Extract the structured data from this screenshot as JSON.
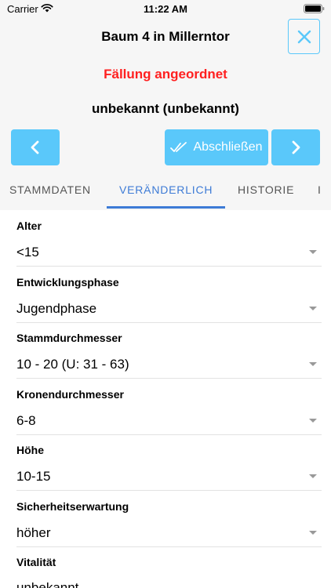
{
  "status_bar": {
    "carrier": "Carrier",
    "time": "11:22 AM"
  },
  "header": {
    "title": "Baum 4 in Millerntor",
    "subtitle": "Fällung angeordnet",
    "species": "unbekannt (unbekannt)",
    "finish_label": "Abschließen"
  },
  "tabs": [
    "STAMMDATEN",
    "VERÄNDERLICH",
    "HISTORIE",
    "I"
  ],
  "active_tab": "VERÄNDERLICH",
  "fields": [
    {
      "label": "Alter",
      "value": "<15"
    },
    {
      "label": "Entwicklungsphase",
      "value": "Jugendphase"
    },
    {
      "label": "Stammdurchmesser",
      "value": "10 - 20 (U: 31 - 63)"
    },
    {
      "label": "Kronendurchmesser",
      "value": "6-8"
    },
    {
      "label": "Höhe",
      "value": "10-15"
    },
    {
      "label": "Sicherheitserwartung",
      "value": "höher"
    },
    {
      "label": "Vitalität",
      "value": "unbekannt"
    }
  ],
  "icons": {
    "wifi": "wifi-icon",
    "battery": "battery-icon",
    "close": "close-icon",
    "prev": "chevron-left-icon",
    "next": "chevron-right-icon",
    "finish": "double-check-icon",
    "dropdown": "triangle-down-icon"
  },
  "colors": {
    "accent": "#5ac8fa",
    "alert": "#ff2020",
    "tab_active": "#3d7bd6",
    "header_bg": "#f6f6f6"
  }
}
